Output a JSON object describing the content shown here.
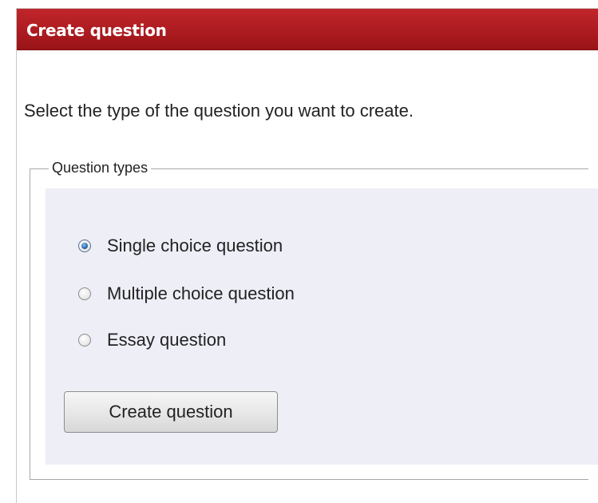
{
  "window": {
    "title": "Create question"
  },
  "instruction": "Select the type of the question you want to create.",
  "question_types": {
    "legend": "Question types",
    "options": [
      {
        "label": "Single choice question",
        "checked": true
      },
      {
        "label": "Multiple choice question",
        "checked": false
      },
      {
        "label": "Essay question",
        "checked": false
      }
    ]
  },
  "actions": {
    "create_label": "Create question"
  },
  "colors": {
    "title_bar": "#b01d22",
    "content_background": "#eeeef7"
  }
}
